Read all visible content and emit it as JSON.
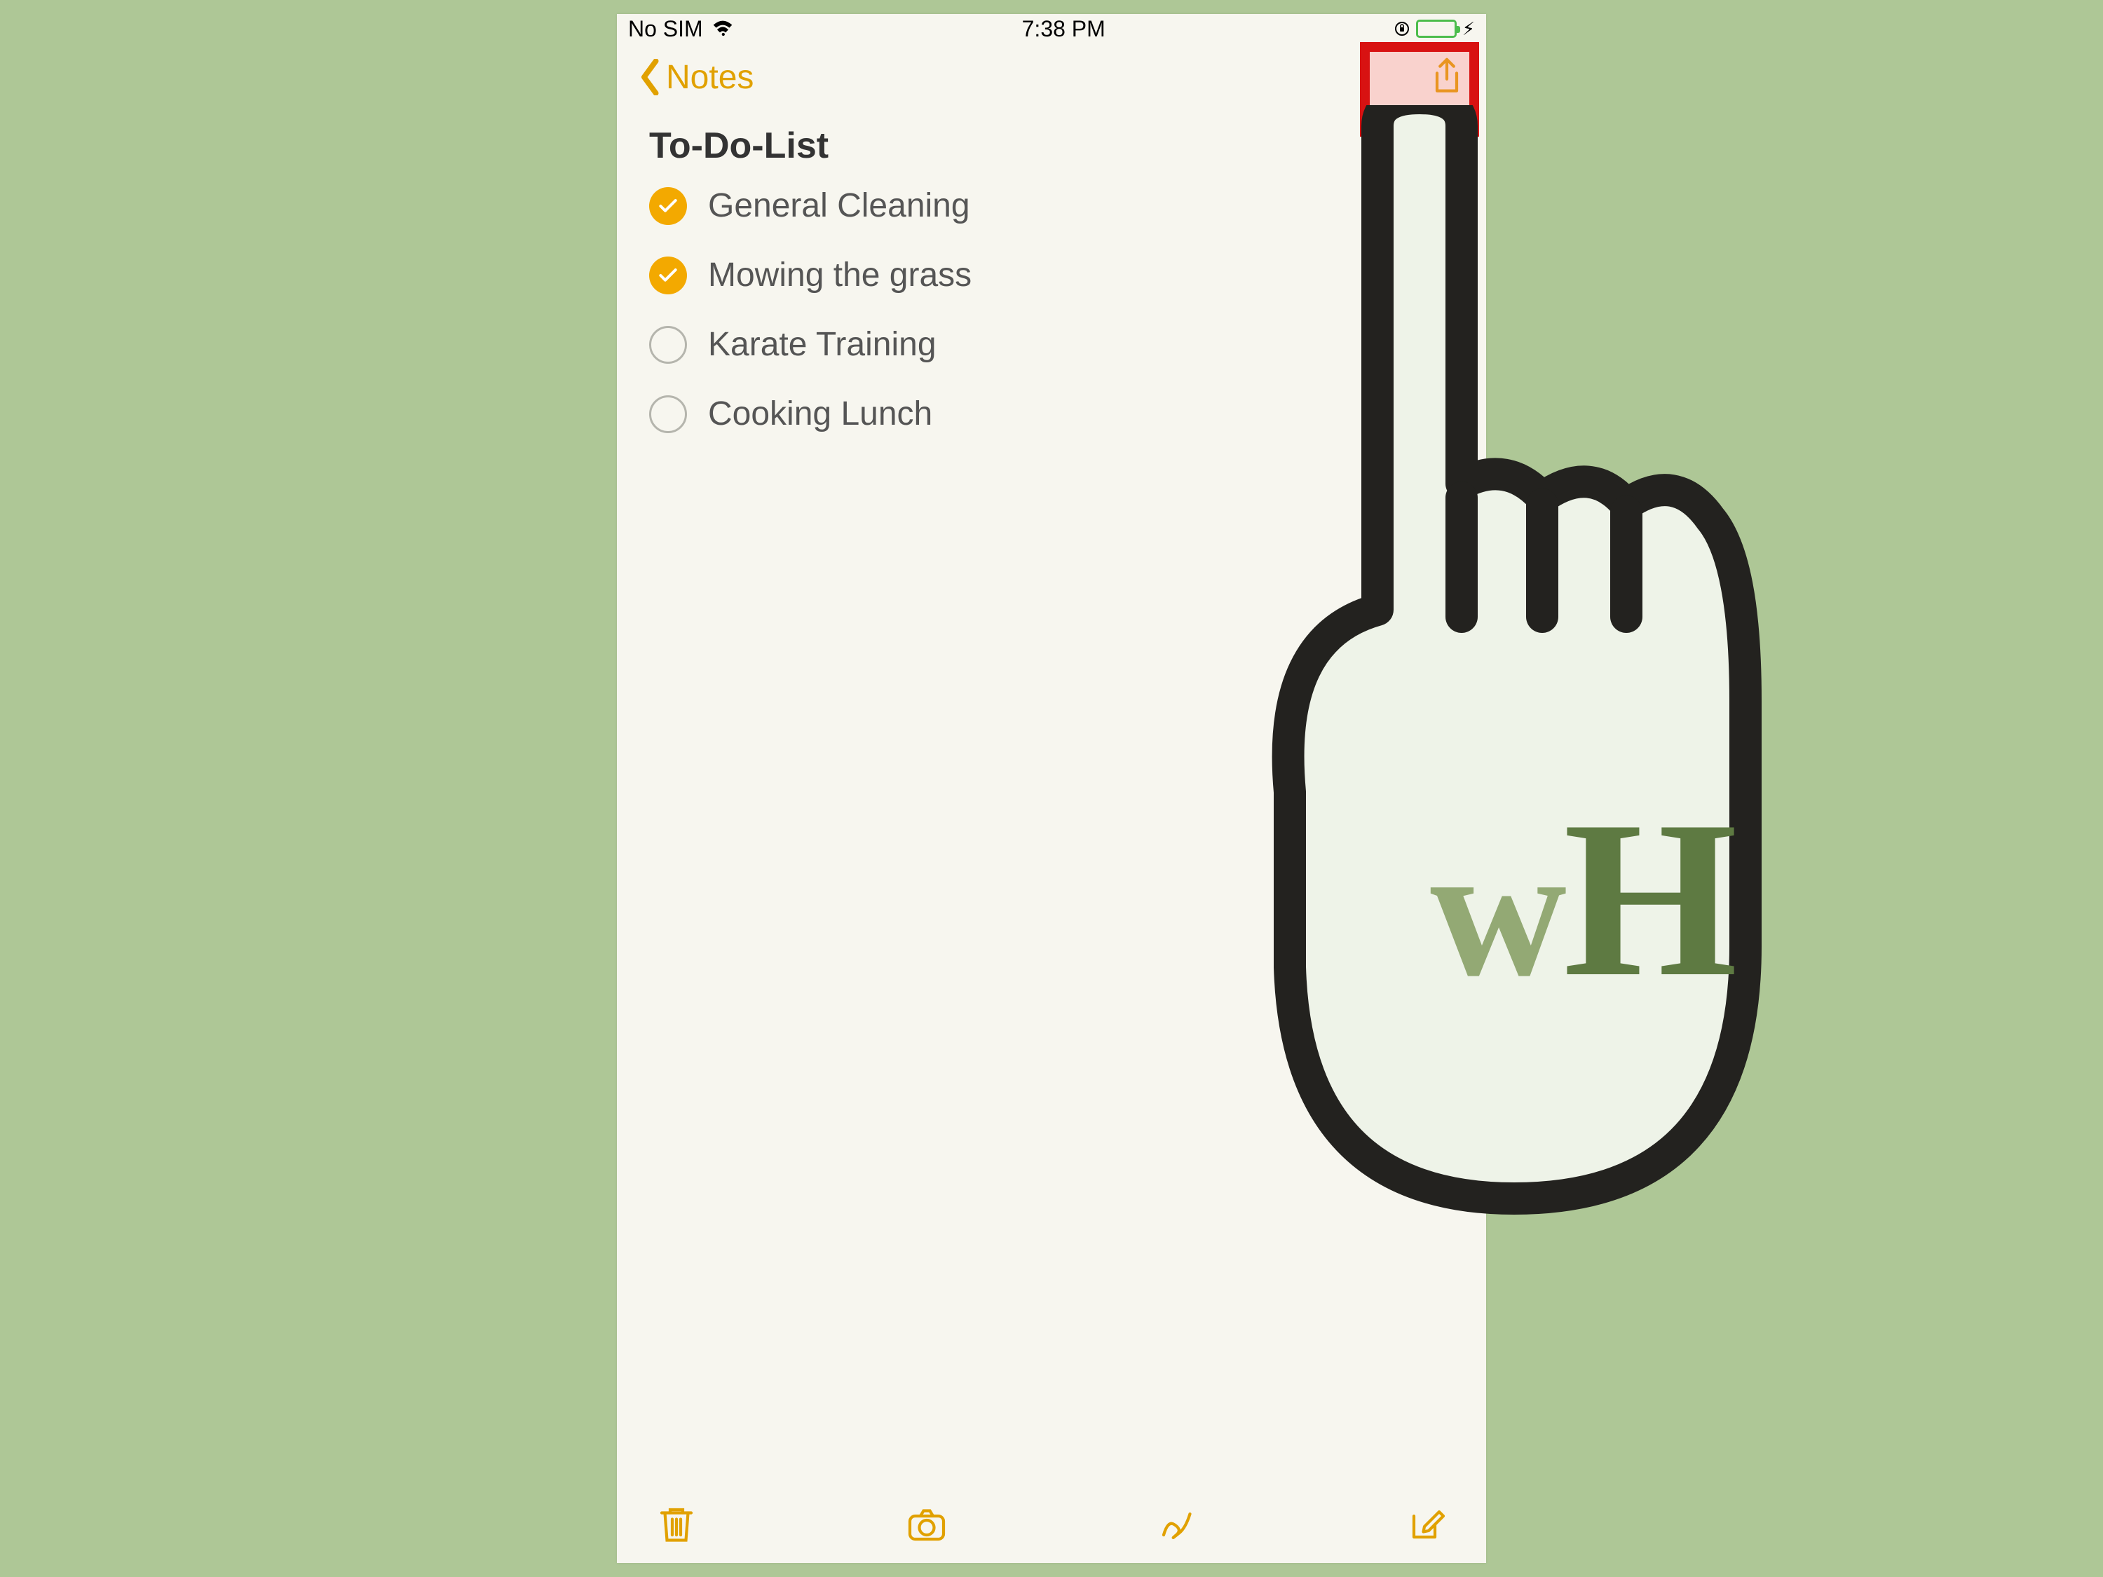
{
  "status": {
    "carrier": "No SIM",
    "time": "7:38 PM"
  },
  "nav": {
    "back_label": "Notes"
  },
  "note": {
    "title": "To-Do-List",
    "items": [
      {
        "label": "General Cleaning",
        "checked": true
      },
      {
        "label": "Mowing the grass",
        "checked": true
      },
      {
        "label": "Karate Training",
        "checked": false
      },
      {
        "label": "Cooking Lunch",
        "checked": false
      }
    ]
  },
  "overlay": {
    "logo_w": "w",
    "logo_h": "H"
  },
  "colors": {
    "accent": "#e1a100",
    "highlight": "#d81212",
    "background": "#aec796"
  }
}
